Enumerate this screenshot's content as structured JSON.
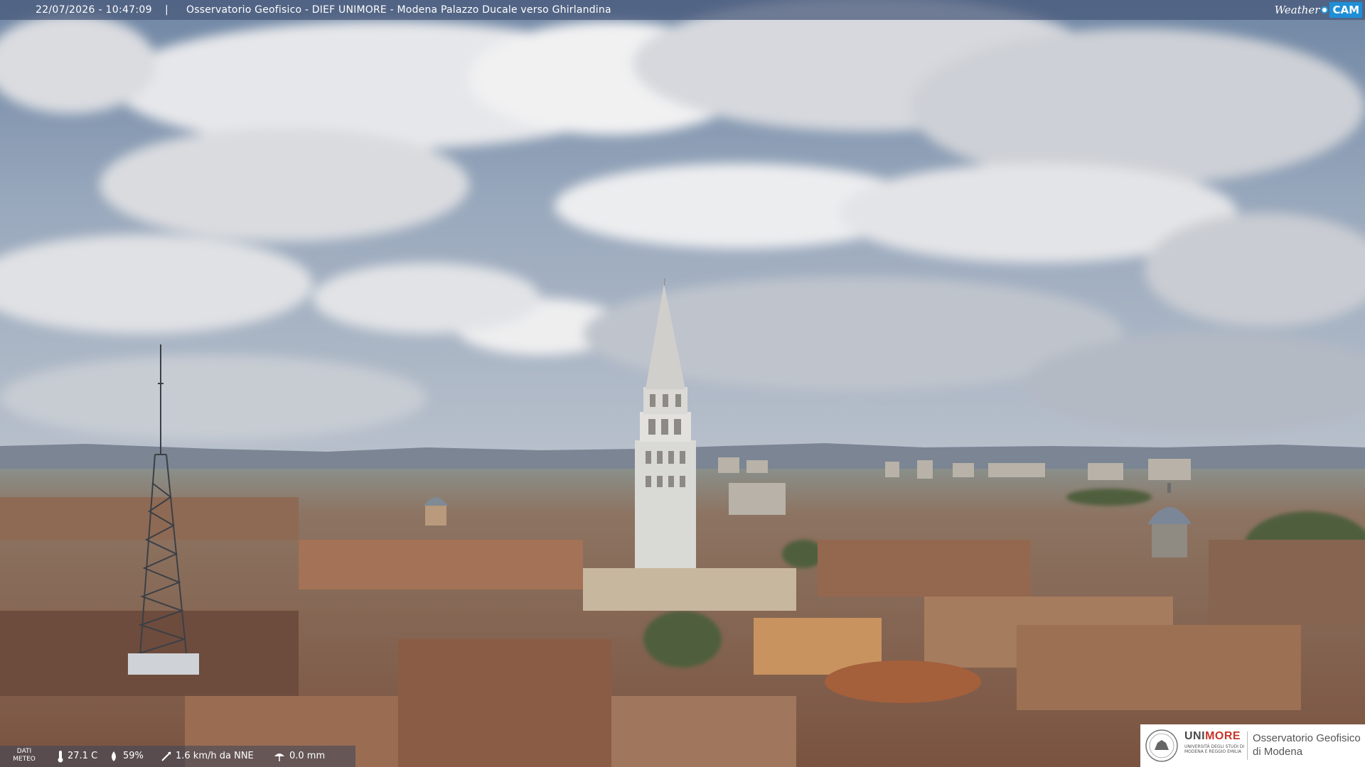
{
  "overlay": {
    "timestamp": "22/07/2026 - 10:47:09",
    "separator": "|",
    "location": "Osservatorio Geofisico - DIEF UNIMORE - Modena Palazzo Ducale verso Ghirlandina",
    "brand_word": "Weather",
    "brand_cam": "CAM"
  },
  "meteo_bar": {
    "label": "DATI METEO",
    "temperature": "27.1 C",
    "humidity": "59%",
    "wind": "1.6 km/h da NNE",
    "rain": "0.0 mm",
    "icons": [
      "thermometer-icon",
      "humidity-drop-icon",
      "wind-vane-icon",
      "rain-gauge-icon"
    ]
  },
  "logo": {
    "uni_gray": "UNI",
    "uni_red": "MORE",
    "uni_sub": "UNIVERSITÀ DEGLI STUDI DI MODENA E REGGIO EMILIA",
    "obs_line1": "Osservatorio Geofisico",
    "obs_line2": "di Modena"
  },
  "colors": {
    "sky": "#7d93ad",
    "cloud": "#e4e6ea",
    "roof": "#9a6a4e",
    "tower": "#dcdcdc",
    "accent_red": "#c8352a",
    "brand_blue": "#1f8fd8"
  }
}
